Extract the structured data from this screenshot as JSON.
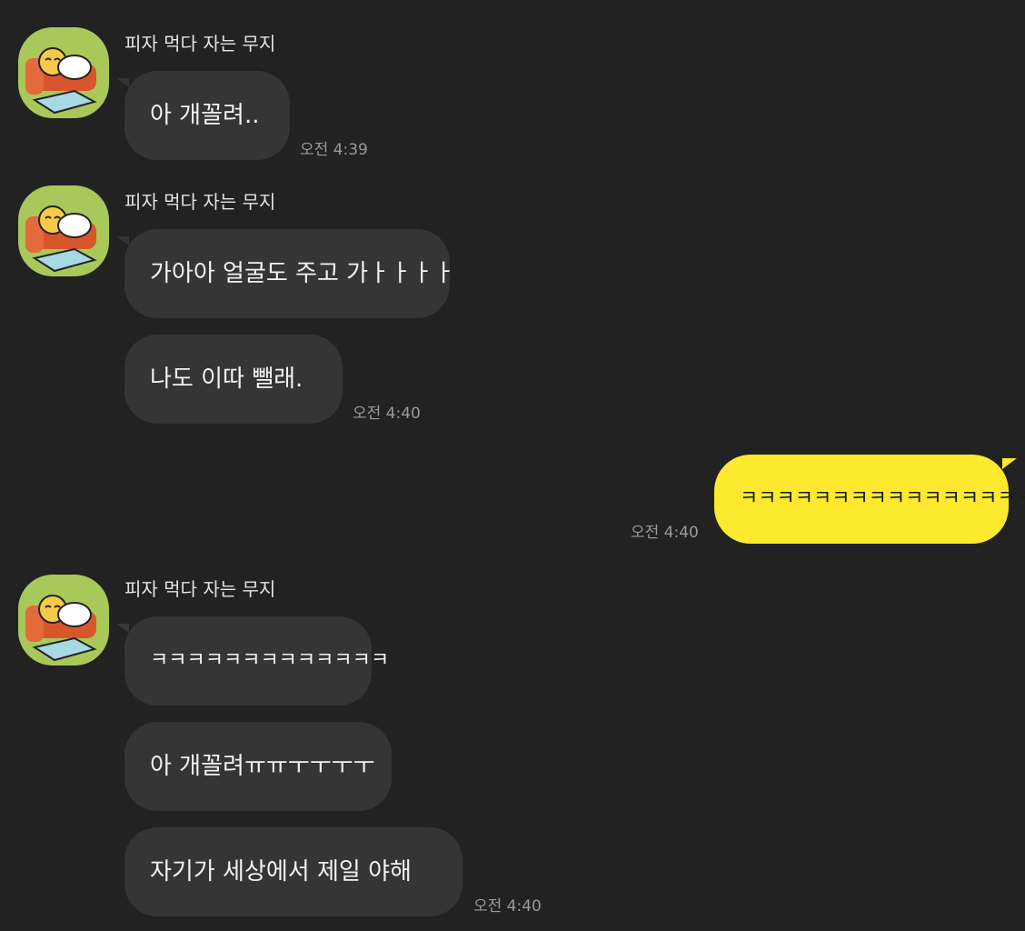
{
  "groups": [
    {
      "sender": "피자 먹다 자는 무지",
      "avatar_icon": "muzi-sleeping-sofa-icon",
      "messages": [
        "아 개꼴려.."
      ],
      "time": "오전 4:39"
    },
    {
      "sender": "피자 먹다 자는 무지",
      "avatar_icon": "muzi-sleeping-sofa-icon",
      "messages": [
        "가아아 얼굴도 주고 가ㅏㅏㅏㅏ",
        "나도 이따 뺄래."
      ],
      "time": "오전 4:40"
    },
    {
      "mine": true,
      "messages": [
        "ㅋㅋㅋㅋㅋㅋㅋㅋㅋㅋㅋㅋㅋㅋㅋㅋ"
      ],
      "time": "오전 4:40"
    },
    {
      "sender": "피자 먹다 자는 무지",
      "avatar_icon": "muzi-sleeping-sofa-icon",
      "messages": [
        "ㅋㅋㅋㅋㅋㅋㅋㅋㅋㅋㅋㅋㅋ",
        "아 개꼴려ㅠㅠㅜㅜㅜㅜ",
        "자기가 세상에서 제일 야해"
      ],
      "time": "오전 4:40"
    }
  ],
  "colors": {
    "background": "#222222",
    "incoming_bubble": "#353535",
    "outgoing_bubble": "#fde92d",
    "avatar_bg": "#a9c85a"
  }
}
